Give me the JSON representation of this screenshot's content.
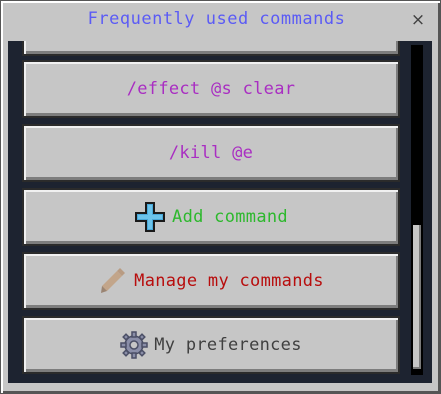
{
  "dialog": {
    "title": "Frequently used commands",
    "close_symbol": "×"
  },
  "commands": [
    {
      "label": "/effect @s clear",
      "color": "#a92ec2"
    },
    {
      "label": "/kill @e",
      "color": "#a92ec2"
    }
  ],
  "actions": {
    "add": {
      "label": "Add command",
      "color": "#2db82d",
      "icon": "plus-icon"
    },
    "manage": {
      "label": "Manage my commands",
      "color": "#b80d0d",
      "icon": "pencil-icon"
    },
    "preferences": {
      "label": "My preferences",
      "color": "#404040",
      "icon": "gear-icon"
    }
  },
  "scroll": {
    "position_fraction": 0.55
  }
}
